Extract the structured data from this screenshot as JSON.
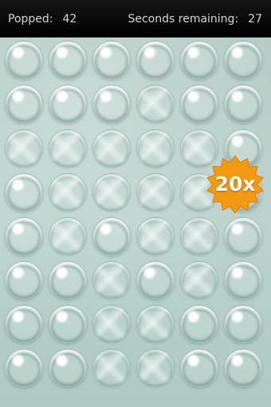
{
  "hud": {
    "popped_label": "Popped:",
    "popped_value": "42",
    "seconds_label": "Seconds remaining:",
    "seconds_value": "27"
  },
  "board": {
    "rows": [
      [
        "intact",
        "intact",
        "intact",
        "intact",
        "intact",
        "intact"
      ],
      [
        "intact",
        "intact",
        "intact",
        "popped",
        "intact",
        "intact"
      ],
      [
        "popped",
        "popped",
        "popped",
        "popped",
        "popped",
        "intact"
      ],
      [
        "intact",
        "popped",
        "popped",
        "popped",
        "popped",
        "intact"
      ],
      [
        "intact",
        "popped",
        "intact",
        "popped",
        "popped",
        "intact"
      ],
      [
        "intact",
        "intact",
        "popped",
        "intact",
        "popped",
        "intact"
      ],
      [
        "intact",
        "intact",
        "popped",
        "popped",
        "intact",
        "intact"
      ],
      [
        "intact",
        "intact",
        "popped",
        "popped",
        "intact",
        "intact"
      ]
    ]
  },
  "bonus": {
    "label": "20x",
    "color": "#f29a12",
    "icon": "starburst-icon"
  }
}
